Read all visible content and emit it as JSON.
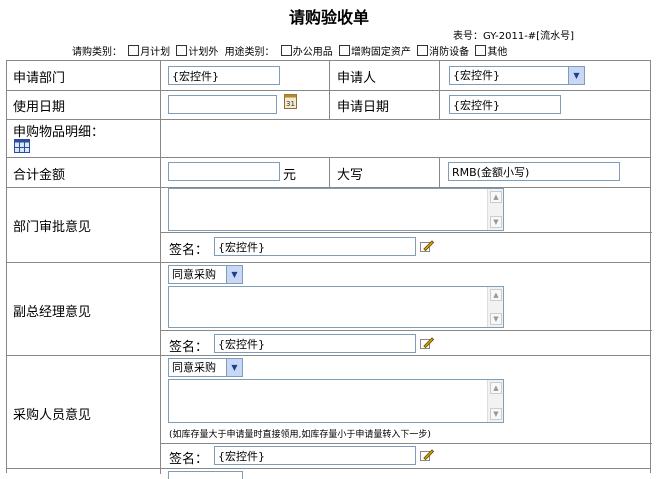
{
  "header": {
    "title": "请购验收单",
    "form_no": "表号：GY-2011-#[流水号]"
  },
  "categories": {
    "purchase_type_label": "请购类别：",
    "purchase_types": [
      "月计划",
      "计划外"
    ],
    "usage_type_label": "用途类别：",
    "usage_types": [
      "办公用品",
      "增购固定资产",
      "消防设备",
      "其他"
    ]
  },
  "form": {
    "dept_label": "申请部门",
    "dept_value": "{宏控件}",
    "applicant_label": "申请人",
    "applicant_value": "{宏控件}",
    "use_date_label": "使用日期",
    "use_date_value": "",
    "apply_date_label": "申请日期",
    "apply_date_value": "{宏控件}",
    "items_label": "申购物品明细：",
    "total_label": "合计金额",
    "total_value": "",
    "total_unit": "元",
    "capital_label": "大写",
    "capital_value": "RMB(金额小写)"
  },
  "approvals": {
    "dept": {
      "label": "部门审批意见",
      "sign_label": "签名：",
      "sign_value": "{宏控件}"
    },
    "vp": {
      "label": "副总经理意见",
      "opinion": "同意采购",
      "sign_label": "签名：",
      "sign_value": "{宏控件}"
    },
    "buyer": {
      "label": "采购人员意见",
      "opinion": "同意采购",
      "note": "(如库存量大于申请量时直接领用,如库存量小于申请量转入下一步)",
      "sign_label": "签名：",
      "sign_value": "{宏控件}"
    }
  }
}
